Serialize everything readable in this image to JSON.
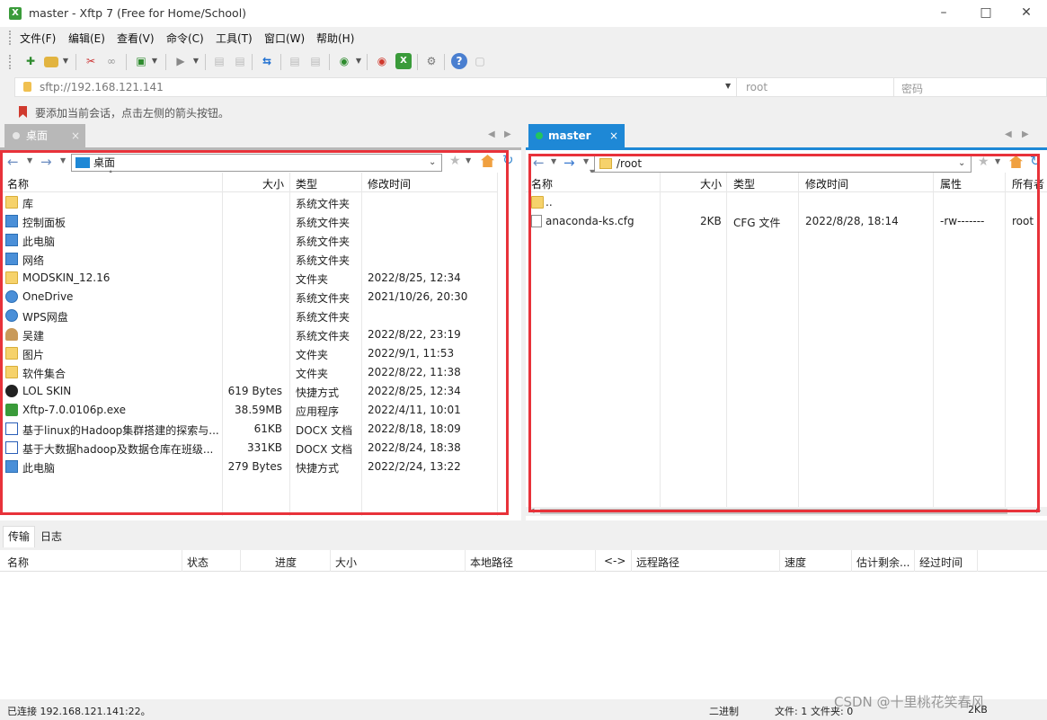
{
  "window": {
    "title": "master - Xftp 7 (Free for Home/School)",
    "app_icon": "xftp-icon"
  },
  "menu": [
    "文件(F)",
    "编辑(E)",
    "查看(V)",
    "命令(C)",
    "工具(T)",
    "窗口(W)",
    "帮助(H)"
  ],
  "address": {
    "host": "sftp://192.168.121.141",
    "username_placeholder": "root",
    "password_placeholder": "密码"
  },
  "hint": "要添加当前会话，点击左侧的箭头按钮。",
  "tabs": {
    "local": "桌面",
    "remote": "master",
    "remote_close": "×"
  },
  "local": {
    "path": "桌面",
    "columns": {
      "name": "名称",
      "size": "大小",
      "type": "类型",
      "modified": "修改时间"
    },
    "rows": [
      {
        "name": "库",
        "size": "",
        "type": "系统文件夹",
        "modified": "",
        "icon": "library-icon"
      },
      {
        "name": "控制面板",
        "size": "",
        "type": "系统文件夹",
        "modified": "",
        "icon": "control-panel-icon"
      },
      {
        "name": "此电脑",
        "size": "",
        "type": "系统文件夹",
        "modified": "",
        "icon": "computer-icon"
      },
      {
        "name": "网络",
        "size": "",
        "type": "系统文件夹",
        "modified": "",
        "icon": "network-icon"
      },
      {
        "name": "MODSKIN_12.16",
        "size": "",
        "type": "文件夹",
        "modified": "2022/8/25, 12:34",
        "icon": "folder-icon"
      },
      {
        "name": "OneDrive",
        "size": "",
        "type": "系统文件夹",
        "modified": "2021/10/26, 20:30",
        "icon": "onedrive-icon"
      },
      {
        "name": "WPS网盘",
        "size": "",
        "type": "系统文件夹",
        "modified": "",
        "icon": "wps-cloud-icon"
      },
      {
        "name": "吴建",
        "size": "",
        "type": "系统文件夹",
        "modified": "2022/8/22, 23:19",
        "icon": "user-folder-icon"
      },
      {
        "name": "图片",
        "size": "",
        "type": "文件夹",
        "modified": "2022/9/1, 11:53",
        "icon": "folder-icon"
      },
      {
        "name": "软件集合",
        "size": "",
        "type": "文件夹",
        "modified": "2022/8/22, 11:38",
        "icon": "folder-icon"
      },
      {
        "name": "LOL SKIN",
        "size": "619 Bytes",
        "type": "快捷方式",
        "modified": "2022/8/25, 12:34",
        "icon": "shortcut-icon"
      },
      {
        "name": "Xftp-7.0.0106p.exe",
        "size": "38.59MB",
        "type": "应用程序",
        "modified": "2022/4/11, 10:01",
        "icon": "exe-icon"
      },
      {
        "name": "基于linux的Hadoop集群搭建的探索与...",
        "size": "61KB",
        "type": "DOCX 文档",
        "modified": "2022/8/18, 18:09",
        "icon": "docx-icon"
      },
      {
        "name": "基于大数据hadoop及数据仓库在班级...",
        "size": "331KB",
        "type": "DOCX 文档",
        "modified": "2022/8/24, 18:38",
        "icon": "docx-icon"
      },
      {
        "name": "此电脑",
        "size": "279 Bytes",
        "type": "快捷方式",
        "modified": "2022/2/24, 13:22",
        "icon": "computer-shortcut-icon"
      }
    ]
  },
  "remote": {
    "path": "/root",
    "columns": {
      "name": "名称",
      "size": "大小",
      "type": "类型",
      "modified": "修改时间",
      "attr": "属性",
      "owner": "所有者"
    },
    "rows": [
      {
        "name": "..",
        "size": "",
        "type": "",
        "modified": "",
        "attr": "",
        "owner": "",
        "icon": "folder-icon"
      },
      {
        "name": "anaconda-ks.cfg",
        "size": "2KB",
        "type": "CFG 文件",
        "modified": "2022/8/28, 18:14",
        "attr": "-rw-------",
        "owner": "root",
        "icon": "file-icon"
      }
    ]
  },
  "bottom_tabs": [
    "传输",
    "日志"
  ],
  "transfer_columns": [
    "名称",
    "状态",
    "进度",
    "大小",
    "本地路径",
    "<->",
    "远程路径",
    "速度",
    "估计剩余...",
    "经过时间"
  ],
  "status": {
    "connected": "已连接 192.168.121.141:22。",
    "mode": "二进制",
    "files": "文件: 1",
    "folders": "文件夹: 0",
    "size": "2KB"
  },
  "watermark": "CSDN @十里桃花笑春风",
  "colors": {
    "accent": "#1e88d6",
    "highlight_box": "#e8323a",
    "connected": "#22c55e"
  }
}
